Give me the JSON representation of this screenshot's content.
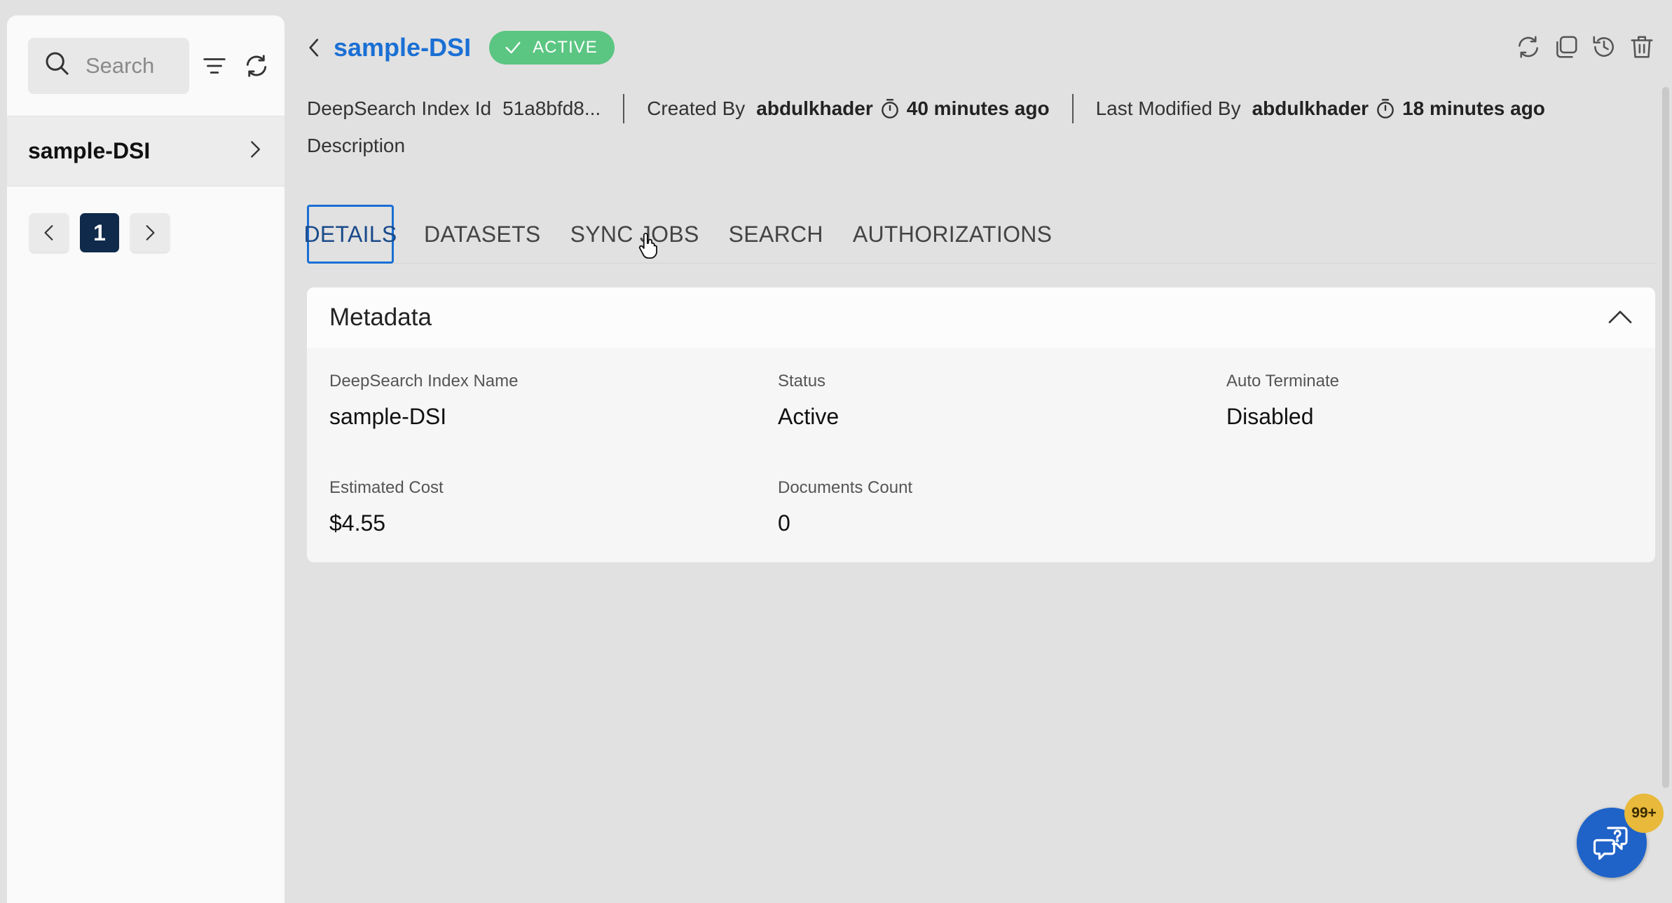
{
  "sidebar": {
    "search_placeholder": "Search",
    "items": [
      {
        "label": "sample-DSI"
      }
    ],
    "pagination": {
      "current_page": "1"
    }
  },
  "header": {
    "title": "sample-DSI",
    "status": "ACTIVE",
    "status_color": "#5bc582",
    "accent_color": "#1a6fd4"
  },
  "meta": {
    "index_id_label": "DeepSearch Index Id",
    "index_id_value": "51a8bfd8...",
    "created_by_label": "Created By",
    "created_by_user": "abdulkhader",
    "created_ago": "40 minutes ago",
    "modified_by_label": "Last Modified By",
    "modified_by_user": "abdulkhader",
    "modified_ago": "18 minutes ago",
    "description_label": "Description"
  },
  "tabs": [
    {
      "label": "DETAILS",
      "active": true
    },
    {
      "label": "DATASETS",
      "active": false
    },
    {
      "label": "SYNC JOBS",
      "active": false
    },
    {
      "label": "SEARCH",
      "active": false
    },
    {
      "label": "AUTHORIZATIONS",
      "active": false
    }
  ],
  "metadata_card": {
    "title": "Metadata",
    "fields": [
      {
        "label": "DeepSearch Index Name",
        "value": "sample-DSI"
      },
      {
        "label": "Status",
        "value": "Active"
      },
      {
        "label": "Auto Terminate",
        "value": "Disabled"
      },
      {
        "label": "Estimated Cost",
        "value": "$4.55"
      },
      {
        "label": "Documents Count",
        "value": "0"
      }
    ]
  },
  "help": {
    "badge": "99+"
  },
  "icons": {
    "top_actions": [
      "refresh-icon",
      "clone-icon",
      "history-icon",
      "delete-icon"
    ]
  }
}
